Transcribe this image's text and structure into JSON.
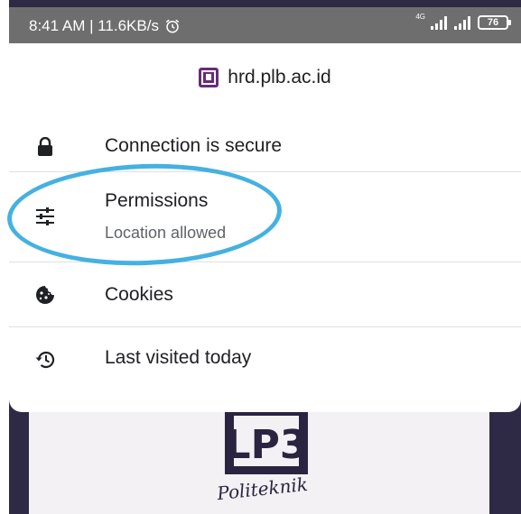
{
  "status_bar": {
    "time_speed": "8:41 AM | 11.6KB/s",
    "network_type": "4G",
    "battery_level": "76",
    "icons": [
      "alarm-icon",
      "signal-icon",
      "signal-icon",
      "battery-icon"
    ]
  },
  "site_info": {
    "url": "hrd.plb.ac.id",
    "rows": [
      {
        "label": "Connection is secure",
        "icon": "lock-icon"
      },
      {
        "label": "Permissions",
        "sublabel": "Location allowed",
        "icon": "tune-icon"
      },
      {
        "label": "Cookies",
        "icon": "cookie-icon"
      },
      {
        "label": "Last visited today",
        "icon": "history-icon"
      }
    ]
  },
  "background_page": {
    "logo_text": "Politeknik"
  },
  "colors": {
    "highlight": "#44b1e1",
    "status_bar": "#6e6e6e",
    "background_page": "#2e2a46"
  }
}
